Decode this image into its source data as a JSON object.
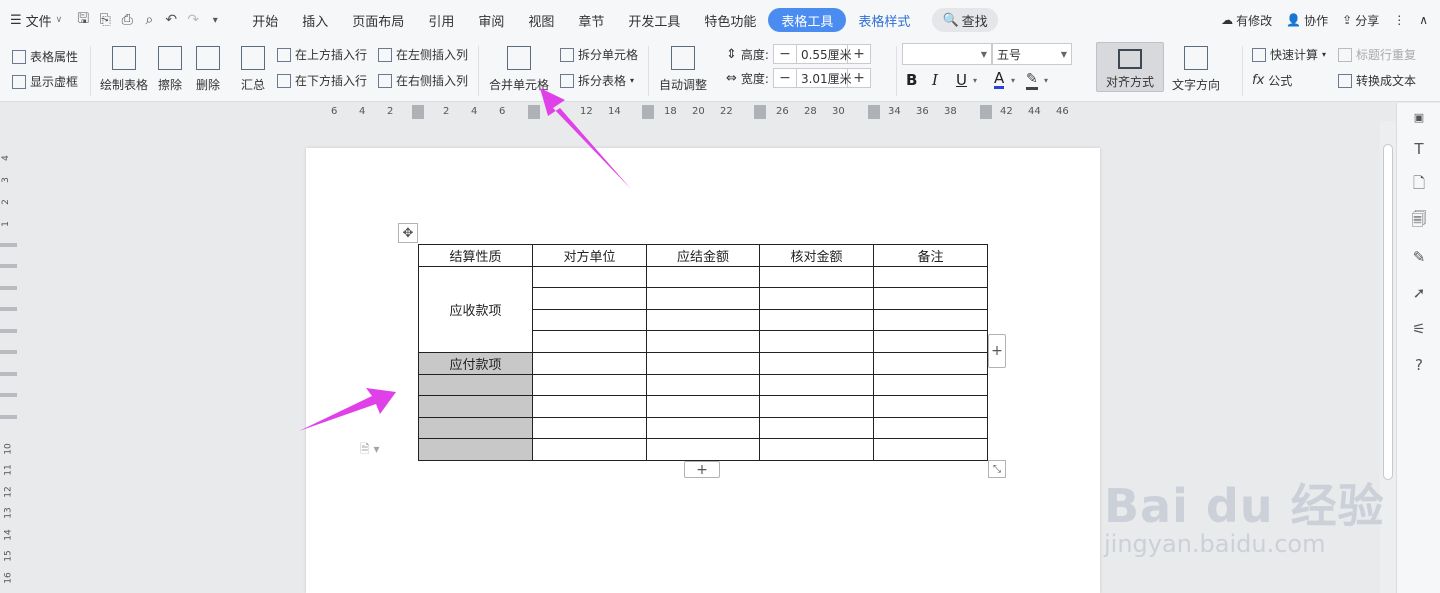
{
  "menubar": {
    "file_label": "文件",
    "tabs": [
      {
        "label": "开始"
      },
      {
        "label": "插入"
      },
      {
        "label": "页面布局"
      },
      {
        "label": "引用"
      },
      {
        "label": "审阅"
      },
      {
        "label": "视图"
      },
      {
        "label": "章节"
      },
      {
        "label": "开发工具"
      },
      {
        "label": "特色功能"
      }
    ],
    "table_tools_label": "表格工具",
    "table_style_label": "表格样式",
    "search_label": "查找",
    "right": {
      "modified": "有修改",
      "collab": "协作",
      "share": "分享"
    }
  },
  "ribbon": {
    "table_props": "表格属性",
    "show_grid": "显示虚框",
    "draw_table": "绘制表格",
    "erase": "擦除",
    "delete": "删除",
    "summary": "汇总",
    "insert_above": "在上方插入行",
    "insert_below": "在下方插入行",
    "insert_left": "在左侧插入列",
    "insert_right": "在右侧插入列",
    "merge_cells": "合并单元格",
    "split_cells": "拆分单元格",
    "split_table": "拆分表格",
    "auto_adjust": "自动调整",
    "height_label": "高度:",
    "height_value": "0.55厘米",
    "width_label": "宽度:",
    "width_value": "3.01厘米",
    "font_name": "",
    "font_size": "五号",
    "bold": "B",
    "italic": "I",
    "underline": "U",
    "font_color": "A",
    "align": "对齐方式",
    "text_dir": "文字方向",
    "quick_calc": "快速计算",
    "title_repeat": "标题行重复",
    "formula": "公式",
    "to_text": "转换成文本"
  },
  "ruler": {
    "h_numbers": [
      "6",
      "4",
      "2",
      "2",
      "4",
      "6",
      "12",
      "14",
      "18",
      "20",
      "22",
      "26",
      "28",
      "30",
      "34",
      "36",
      "38",
      "42",
      "44",
      "46"
    ],
    "v_numbers": [
      "4",
      "3",
      "2",
      "1",
      "10",
      "11",
      "12",
      "13",
      "14",
      "15",
      "16"
    ]
  },
  "table": {
    "headers": [
      "结算性质",
      "对方单位",
      "应结金额",
      "核对金额",
      "备注"
    ],
    "receivable": "应收款项",
    "payable": "应付款项"
  },
  "colors": {
    "accent": "#4a8cf0",
    "arrow": "#e040e8",
    "grey_cell": "#c8c8c8"
  },
  "watermark": {
    "brand": "Bai du 经验",
    "url": "jingyan.baidu.com"
  }
}
